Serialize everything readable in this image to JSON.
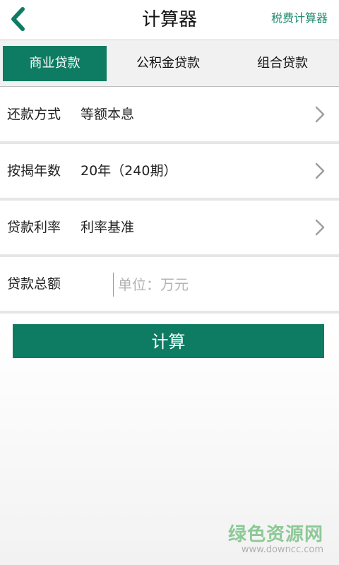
{
  "header": {
    "title": "计算器",
    "right_link": "税费计算器",
    "accent_color": "#0e7c63",
    "back_icon": "chevron-left-icon"
  },
  "tabs": [
    {
      "label": "商业贷款",
      "active": true
    },
    {
      "label": "公积金贷款",
      "active": false
    },
    {
      "label": "组合贷款",
      "active": false
    }
  ],
  "form": {
    "repayment": {
      "label": "还款方式",
      "value": "等额本息"
    },
    "term": {
      "label": "按揭年数",
      "value": "20年（240期）"
    },
    "rate": {
      "label": "贷款利率",
      "value": "利率基准"
    },
    "amount": {
      "label": "贷款总额",
      "placeholder": "单位：万元",
      "value": ""
    }
  },
  "calc_button": "计算",
  "watermark": {
    "text": "绿色资源网",
    "url": "www.downcc.com"
  }
}
